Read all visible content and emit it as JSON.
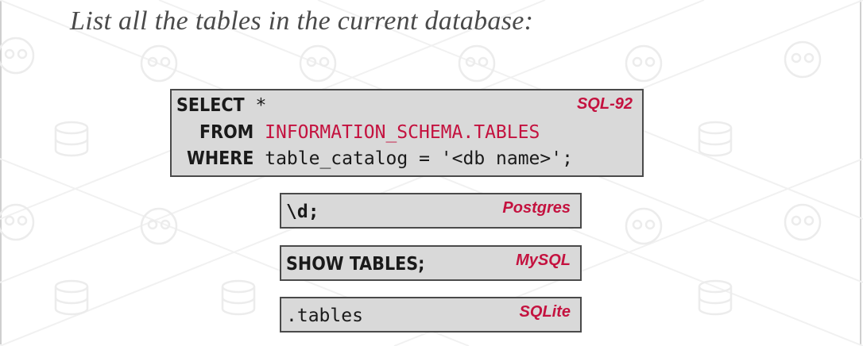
{
  "title": "List all the tables in the current database:",
  "blocks": [
    {
      "dialect": "SQL-92",
      "lines": [
        {
          "keyword": "SELECT",
          "rest": " *",
          "rest_highlight": ""
        },
        {
          "keyword": "FROM",
          "rest": "",
          "rest_highlight": "INFORMATION_SCHEMA.TABLES"
        },
        {
          "keyword": "WHERE",
          "rest": " table_catalog = '<db name>';",
          "rest_highlight": ""
        }
      ]
    },
    {
      "dialect": "Postgres",
      "code": "\\d;"
    },
    {
      "dialect": "MySQL",
      "code": "SHOW TABLES;"
    },
    {
      "dialect": "SQLite",
      "code": ".tables"
    }
  ],
  "colors": {
    "accent": "#c4123f",
    "code_bg": "#d9d9d9",
    "border": "#4a4a4a"
  }
}
